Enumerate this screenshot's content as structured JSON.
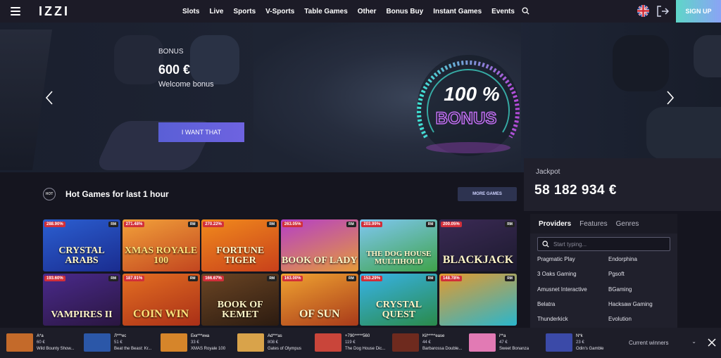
{
  "header": {
    "logo": "IZZI",
    "nav": [
      "Slots",
      "Live",
      "Sports",
      "V-Sports",
      "Table Games",
      "Other",
      "Bonus Buy",
      "Instant Games",
      "Events"
    ],
    "signup": "SIGN UP"
  },
  "hero": {
    "bonus_label": "BONUS",
    "bonus_amount": "600 €",
    "bonus_desc": "Welcome bonus",
    "cta": "I WANT THAT",
    "art_text_1": "100 %",
    "art_text_2": "BONUS"
  },
  "hot": {
    "icon_text": "HOT",
    "title": "Hot Games for last 1 hour",
    "more": "MORE GAMES",
    "games": [
      {
        "name": "CRYSTAL ARABS",
        "pct": "288.90%",
        "rm": "RM",
        "bg": "linear-gradient(160deg,#2b5fd1,#1a2c8f)"
      },
      {
        "name": "XMAS ROYALE 100",
        "pct": "271.48%",
        "rm": "RM",
        "bg": "linear-gradient(160deg,#f2a13a,#c2451f)"
      },
      {
        "name": "FORTUNE TIGER",
        "pct": "270.22%",
        "rm": "RM",
        "bg": "linear-gradient(160deg,#f18a1c,#c8401b)"
      },
      {
        "name": "BOOK OF LADY",
        "pct": "263.05%",
        "rm": "RM",
        "bg": "linear-gradient(160deg,#b53fc7,#e59a3a)"
      },
      {
        "name": "THE DOG HOUSE MULTIHOLD",
        "pct": "203.99%",
        "rm": "RM",
        "bg": "linear-gradient(160deg,#7fc7f2,#3fa34a)"
      },
      {
        "name": "BLACKJACK",
        "pct": "200.05%",
        "rm": "RM",
        "bg": "linear-gradient(160deg,#3b2a55,#1c1a2e)"
      },
      {
        "name": "VAMPIRES II",
        "pct": "193.60%",
        "rm": "RM",
        "bg": "linear-gradient(160deg,#4a2a8c,#2a1640)"
      },
      {
        "name": "COIN WIN",
        "pct": "187.91%",
        "rm": "RM",
        "bg": "linear-gradient(160deg,#e46f22,#a92f17)"
      },
      {
        "name": "BOOK OF KEMET",
        "pct": "166.67%",
        "rm": "RM",
        "bg": "linear-gradient(160deg,#6b4524,#2c1b10)"
      },
      {
        "name": "OF SUN",
        "pct": "163.00%",
        "rm": "RM",
        "bg": "linear-gradient(160deg,#f0a331,#a83a1a)"
      },
      {
        "name": "CRYSTAL QUEST",
        "pct": "153.29%",
        "rm": "RM",
        "bg": "linear-gradient(160deg,#38b3e8,#2a8a4a)"
      },
      {
        "name": "",
        "pct": "148.78%",
        "rm": "RM",
        "bg": "linear-gradient(160deg,#e49a2e,#2ab6cc)"
      }
    ]
  },
  "jackpot": {
    "label": "Jackpot",
    "value": "58 182 934 €"
  },
  "providers": {
    "tabs": [
      "Providers",
      "Features",
      "Genres"
    ],
    "search_placeholder": "Start typing...",
    "list": [
      "Pragmatic Play",
      "Endorphina",
      "3 Oaks Gaming",
      "Pgsoft",
      "Amusnet Interactive",
      "BGaming",
      "Belatra",
      "Hacksaw Gaming",
      "Thunderkick",
      "Evolution"
    ]
  },
  "winners": {
    "items": [
      {
        "name": "A*a",
        "amount": "60 €",
        "game": "Wild Bounty Show...",
        "bg": "#c46a2a"
      },
      {
        "name": "Л***ec",
        "amount": "51 €",
        "game": "Beat the Beast: Kr...",
        "bg": "#2b57a8"
      },
      {
        "name": "Екк***ина",
        "amount": "33 €",
        "game": "XMAS Royale 100",
        "bg": "#d6852a"
      },
      {
        "name": "Ad***as",
        "amount": "808 €",
        "game": "Gates of Olympus",
        "bg": "#d9a34a"
      },
      {
        "name": "+790*****560",
        "amount": "119 €",
        "game": "The Dog House Dic...",
        "bg": "#c9453a"
      },
      {
        "name": "Kil*****ease",
        "amount": "44 €",
        "game": "Barbarossa Double...",
        "bg": "#6e2a1e"
      },
      {
        "name": "i**a",
        "amount": "47 €",
        "game": "Sweet Bonanza",
        "bg": "#e27ab4"
      },
      {
        "name": "N*k",
        "amount": "23 €",
        "game": "Odin's Gamble",
        "bg": "#3b4aa8"
      }
    ],
    "selector": "Current winners"
  }
}
